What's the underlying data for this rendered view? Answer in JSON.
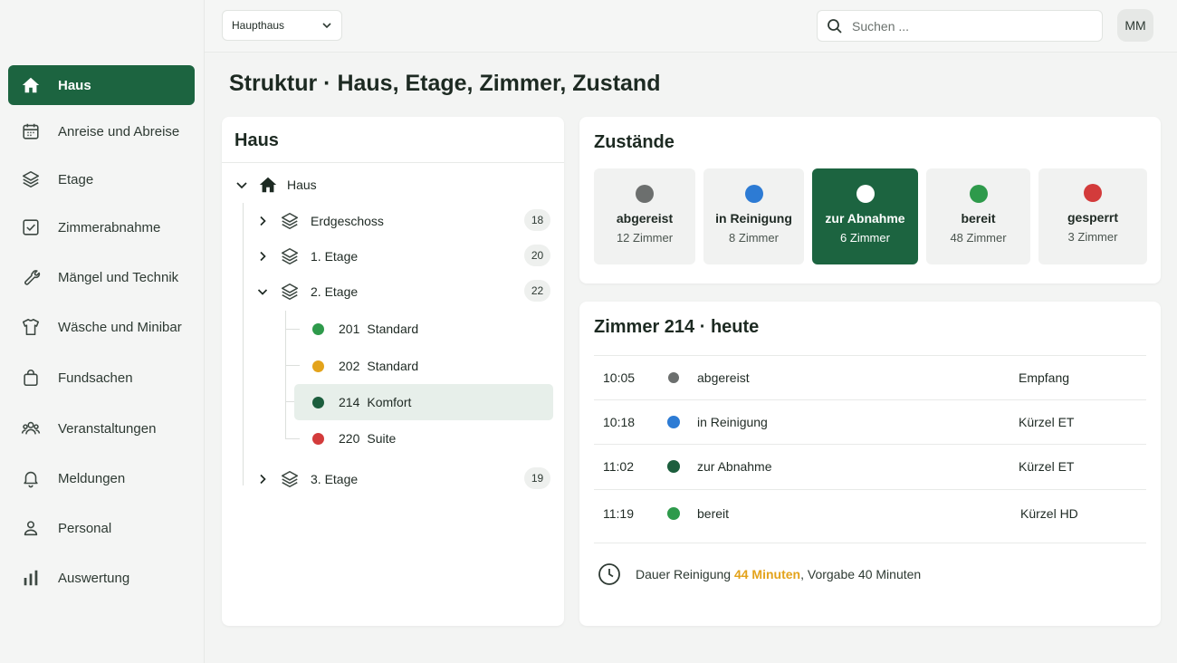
{
  "colors": {
    "primary": "#1c6440",
    "status_abgereist": "#6c6f6e",
    "status_reinigung": "#2d7bd4",
    "status_abnahme": "#1c5e3d",
    "status_bereit": "#2e9a4b",
    "status_gesperrt": "#d33b3b",
    "status_pending": "#e3a31b",
    "highlight": "#e3a31b"
  },
  "sidebar": {
    "items": [
      {
        "label": "Haus",
        "icon": "home-icon",
        "active": true
      },
      {
        "label": "Anreise und Abreise",
        "icon": "calendar-icon"
      },
      {
        "label": "Etage",
        "icon": "layers-icon"
      },
      {
        "label": "Zimmerabnahme",
        "icon": "checkbox-icon"
      },
      {
        "label": "Mängel und Technik",
        "icon": "wrench-icon"
      },
      {
        "label": "Wäsche und Minibar",
        "icon": "shirt-icon"
      },
      {
        "label": "Fundsachen",
        "icon": "bag-icon"
      },
      {
        "label": "Veranstaltungen",
        "icon": "group-icon"
      },
      {
        "label": "Meldungen",
        "icon": "bell-icon"
      },
      {
        "label": "Personal",
        "icon": "person-icon"
      },
      {
        "label": "Auswertung",
        "icon": "bar-chart-icon"
      }
    ]
  },
  "topbar": {
    "house_select": "Haupthaus",
    "search_placeholder": "Suchen ...",
    "avatar_initials": "MM"
  },
  "page": {
    "title": "Struktur · Haus, Etage, Zimmer, Zustand"
  },
  "tree": {
    "title": "Haus",
    "root_label": "Haus",
    "floors": [
      {
        "label": "Erdgeschoss",
        "count": "18",
        "expanded": false
      },
      {
        "label": "1. Etage",
        "count": "20",
        "expanded": false
      },
      {
        "label": "2. Etage",
        "count": "22",
        "expanded": true,
        "rooms": [
          {
            "number": "201",
            "type": "Standard",
            "status": "bereit"
          },
          {
            "number": "202",
            "type": "Standard",
            "status": "pending"
          },
          {
            "number": "214",
            "type": "Komfort",
            "status": "abnahme",
            "selected": true
          },
          {
            "number": "220",
            "type": "Suite",
            "status": "gesperrt"
          }
        ]
      },
      {
        "label": "3. Etage",
        "count": "19",
        "expanded": false
      }
    ]
  },
  "states": {
    "title": "Zustände",
    "items": [
      {
        "label": "abgereist",
        "count": "12 Zimmer",
        "color": "#6c6f6e"
      },
      {
        "label": "in Reinigung",
        "count": "8 Zimmer",
        "color": "#2d7bd4"
      },
      {
        "label": "zur Abnahme",
        "count": "6 Zimmer",
        "color": "#ffffff",
        "active": true
      },
      {
        "label": "bereit",
        "count": "48 Zimmer",
        "color": "#2e9a4b"
      },
      {
        "label": "gesperrt",
        "count": "3 Zimmer",
        "color": "#d33b3b"
      }
    ]
  },
  "history": {
    "title": "Zimmer 214 · heute",
    "rows": [
      {
        "time": "10:05",
        "status": "abgereist",
        "by": "Empfang",
        "color": "#6c6f6e"
      },
      {
        "time": "10:18",
        "status": "in Reinigung",
        "by": "Kürzel ET",
        "color": "#2d7bd4"
      },
      {
        "time": "11:02",
        "status": "zur Abnahme",
        "by": "Kürzel ET",
        "color": "#1c5e3d"
      },
      {
        "time": "11:19",
        "status": "bereit",
        "by": "Kürzel HD",
        "color": "#2e9a4b"
      }
    ],
    "duration_prefix": "Dauer Reinigung ",
    "duration_value": "44 Minuten",
    "duration_suffix": ", Vorgabe 40 Minuten"
  }
}
